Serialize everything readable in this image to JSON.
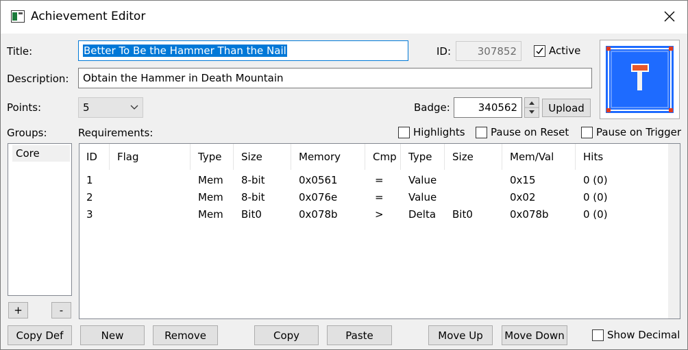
{
  "window": {
    "title": "Achievement Editor"
  },
  "labels": {
    "title": "Title:",
    "description": "Description:",
    "points": "Points:",
    "groups": "Groups:",
    "requirements": "Requirements:",
    "id": "ID:",
    "badge": "Badge:"
  },
  "fields": {
    "title_value": "Better To Be the Hammer Than the Nail",
    "description_value": "Obtain the Hammer in Death Mountain",
    "points_value": "5",
    "id_value": "307852",
    "badge_value": "340562"
  },
  "checks": {
    "active": {
      "label": "Active",
      "checked": true
    },
    "highlights": {
      "label": "Highlights",
      "checked": false
    },
    "pause_on_reset": {
      "label": "Pause on Reset",
      "checked": false
    },
    "pause_on_trigger": {
      "label": "Pause on Trigger",
      "checked": false
    },
    "show_decimal": {
      "label": "Show Decimal",
      "checked": false
    }
  },
  "buttons": {
    "upload": "Upload",
    "group_add": "+",
    "group_remove": "-",
    "copy_def": "Copy Def",
    "new": "New",
    "remove": "Remove",
    "copy": "Copy",
    "paste": "Paste",
    "move_up": "Move Up",
    "move_down": "Move Down"
  },
  "groups": [
    "Core"
  ],
  "requirements": {
    "columns": [
      "ID",
      "Flag",
      "Type",
      "Size",
      "Memory",
      "Cmp",
      "Type",
      "Size",
      "Mem/Val",
      "Hits"
    ],
    "rows": [
      [
        "1",
        "",
        "Mem",
        "8-bit",
        "0x0561",
        "=",
        "Value",
        "",
        "0x15",
        "0 (0)"
      ],
      [
        "2",
        "",
        "Mem",
        "8-bit",
        "0x076e",
        "=",
        "Value",
        "",
        "0x02",
        "0 (0)"
      ],
      [
        "3",
        "",
        "Mem",
        "Bit0",
        "0x078b",
        ">",
        "Delta",
        "Bit0",
        "0x078b",
        "0 (0)"
      ]
    ]
  },
  "icons": {
    "app": "window-icon",
    "close": "close-icon",
    "dropdown": "chevron-down-icon",
    "spin": "spin-arrows-icon",
    "badge": "hammer-badge-image"
  },
  "colors": {
    "accent": "#0078d7",
    "badge_bg": "#1e6bff"
  }
}
